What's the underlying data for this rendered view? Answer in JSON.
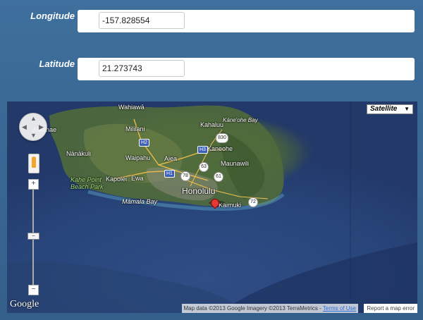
{
  "form": {
    "longitude_label": "Longitude",
    "longitude_value": "-157.828554",
    "latitude_label": "Latitude",
    "latitude_value": "21.273743"
  },
  "map": {
    "type_control": "Satellite",
    "zoom_in": "+",
    "zoom_out": "−",
    "logo": "Google",
    "attribution": "Map data ©2013 Google Imagery ©2013 TerraMetrics - ",
    "terms_link": "Terms of Use",
    "report_link": "Report a map error",
    "places": {
      "wahiawa": "Wahiawā",
      "mililani": "Mililani",
      "waianae": "Waianae",
      "nanakuli": "Nānākuli",
      "waipahu": "Waipahu",
      "aiea": "Aiea",
      "kahaluu": "Kahaluu",
      "kaneohe_bay": "Kāne'ohe Bay",
      "kaneohe": "Kaneohe",
      "maunawili": "Maunawili",
      "kapolei": "Kapolei",
      "ewa": "Ewa",
      "kahe_point": "Kahe Point",
      "beach_park": "Beach Park",
      "honolulu": "Honolulu",
      "mamala_bay": "Māmala Bay",
      "kaimuki": "Kaimuki"
    },
    "routes": {
      "h2": "H2",
      "h3": "H3",
      "h1": "H1",
      "r830": "830",
      "r78": "78",
      "r63": "63",
      "r61": "61",
      "r72": "72"
    }
  }
}
